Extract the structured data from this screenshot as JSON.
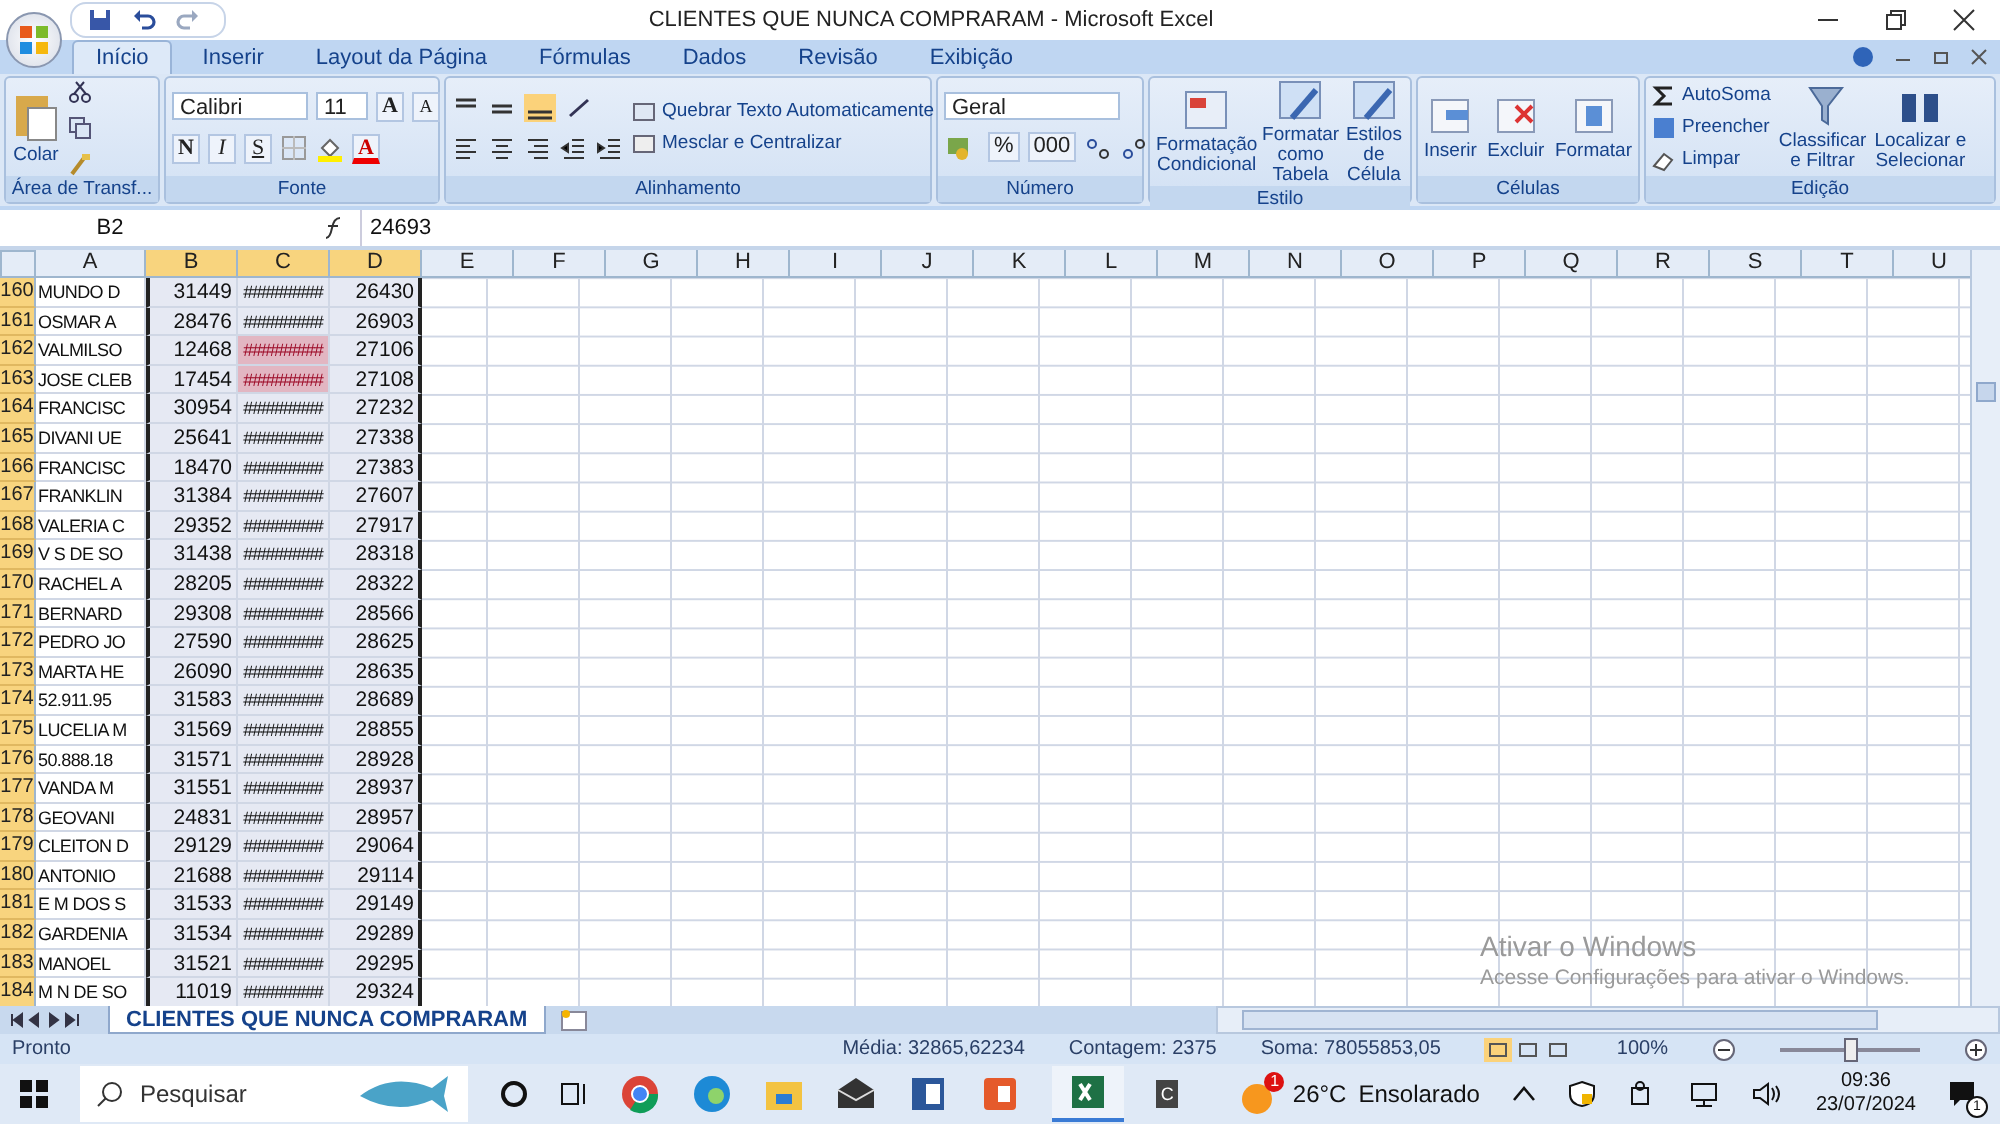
{
  "window": {
    "title": "CLIENTES QUE NUNCA COMPRARAM - Microsoft Excel"
  },
  "tabs": [
    {
      "label": "Início",
      "selected": true
    },
    {
      "label": "Inserir",
      "selected": false
    },
    {
      "label": "Layout da Página",
      "selected": false
    },
    {
      "label": "Fórmulas",
      "selected": false
    },
    {
      "label": "Dados",
      "selected": false
    },
    {
      "label": "Revisão",
      "selected": false
    },
    {
      "label": "Exibição",
      "selected": false
    }
  ],
  "ribbon": {
    "clipboard": {
      "paste": "Colar",
      "title": "Área de Transf..."
    },
    "font": {
      "name": "Calibri",
      "size": "11",
      "grow": "A",
      "shrink": "A",
      "styles": [
        "N",
        "I",
        "S"
      ],
      "color_letter": "A",
      "title": "Fonte"
    },
    "alignment": {
      "wrap": "Quebrar Texto Automaticamente",
      "merge": "Mesclar e Centralizar",
      "title": "Alinhamento"
    },
    "number": {
      "format": "Geral",
      "buttons": [
        "%",
        "000"
      ],
      "title": "Número"
    },
    "style": {
      "buttons": [
        "Formatação\nCondicional",
        "Formatar\ncomo Tabela",
        "Estilos de\nCélula"
      ],
      "title": "Estilo"
    },
    "cells": {
      "buttons": [
        "Inserir",
        "Excluir",
        "Formatar"
      ],
      "title": "Células"
    },
    "editing": {
      "items": [
        "AutoSoma",
        "Preencher",
        "Limpar"
      ],
      "buttons": [
        "Classificar\ne Filtrar",
        "Localizar e\nSelecionar"
      ],
      "title": "Edição"
    }
  },
  "name_box": "B2",
  "formula": "24693",
  "columns": [
    {
      "label": "A",
      "selected": false
    },
    {
      "label": "B",
      "selected": true
    },
    {
      "label": "C",
      "selected": true
    },
    {
      "label": "D",
      "selected": true
    },
    {
      "label": "E",
      "selected": false
    },
    {
      "label": "F",
      "selected": false
    },
    {
      "label": "G",
      "selected": false
    },
    {
      "label": "H",
      "selected": false
    },
    {
      "label": "I",
      "selected": false
    },
    {
      "label": "J",
      "selected": false
    },
    {
      "label": "K",
      "selected": false
    },
    {
      "label": "L",
      "selected": false
    },
    {
      "label": "M",
      "selected": false
    },
    {
      "label": "N",
      "selected": false
    },
    {
      "label": "O",
      "selected": false
    },
    {
      "label": "P",
      "selected": false
    },
    {
      "label": "Q",
      "selected": false
    },
    {
      "label": "R",
      "selected": false
    },
    {
      "label": "S",
      "selected": false
    },
    {
      "label": "T",
      "selected": false
    },
    {
      "label": "U",
      "selected": false
    }
  ],
  "rows": [
    {
      "num": "160",
      "a": "MUNDO D",
      "b": "31449",
      "c": "#########",
      "d": "26430",
      "highlighted": false
    },
    {
      "num": "161",
      "a": "OSMAR A",
      "b": "28476",
      "c": "#########",
      "d": "26903",
      "highlighted": false
    },
    {
      "num": "162",
      "a": "VALMILSO",
      "b": "12468",
      "c": "#########",
      "d": "27106",
      "highlighted": true
    },
    {
      "num": "163",
      "a": "JOSE CLEB",
      "b": "17454",
      "c": "#########",
      "d": "27108",
      "highlighted": true
    },
    {
      "num": "164",
      "a": "FRANCISC",
      "b": "30954",
      "c": "#########",
      "d": "27232",
      "highlighted": false
    },
    {
      "num": "165",
      "a": "DIVANI UE",
      "b": "25641",
      "c": "#########",
      "d": "27338",
      "highlighted": false
    },
    {
      "num": "166",
      "a": "FRANCISC",
      "b": "18470",
      "c": "#########",
      "d": "27383",
      "highlighted": false
    },
    {
      "num": "167",
      "a": "FRANKLIN",
      "b": "31384",
      "c": "#########",
      "d": "27607",
      "highlighted": false
    },
    {
      "num": "168",
      "a": "VALERIA C",
      "b": "29352",
      "c": "#########",
      "d": "27917",
      "highlighted": false
    },
    {
      "num": "169",
      "a": "V S DE SO",
      "b": "31438",
      "c": "#########",
      "d": "28318",
      "highlighted": false
    },
    {
      "num": "170",
      "a": "RACHEL A",
      "b": "28205",
      "c": "#########",
      "d": "28322",
      "highlighted": false
    },
    {
      "num": "171",
      "a": "BERNARD",
      "b": "29308",
      "c": "#########",
      "d": "28566",
      "highlighted": false
    },
    {
      "num": "172",
      "a": "PEDRO JO",
      "b": "27590",
      "c": "#########",
      "d": "28625",
      "highlighted": false
    },
    {
      "num": "173",
      "a": "MARTA HE",
      "b": "26090",
      "c": "#########",
      "d": "28635",
      "highlighted": false
    },
    {
      "num": "174",
      "a": "52.911.95",
      "b": "31583",
      "c": "#########",
      "d": "28689",
      "highlighted": false
    },
    {
      "num": "175",
      "a": "LUCELIA M",
      "b": "31569",
      "c": "#########",
      "d": "28855",
      "highlighted": false
    },
    {
      "num": "176",
      "a": "50.888.18",
      "b": "31571",
      "c": "#########",
      "d": "28928",
      "highlighted": false
    },
    {
      "num": "177",
      "a": "VANDA M",
      "b": "31551",
      "c": "#########",
      "d": "28937",
      "highlighted": false
    },
    {
      "num": "178",
      "a": "GEOVANI",
      "b": "24831",
      "c": "#########",
      "d": "28957",
      "highlighted": false
    },
    {
      "num": "179",
      "a": "CLEITON D",
      "b": "29129",
      "c": "#########",
      "d": "29064",
      "highlighted": false
    },
    {
      "num": "180",
      "a": "ANTONIO",
      "b": "21688",
      "c": "#########",
      "d": "29114",
      "highlighted": false
    },
    {
      "num": "181",
      "a": "E M DOS S",
      "b": "31533",
      "c": "#########",
      "d": "29149",
      "highlighted": false
    },
    {
      "num": "182",
      "a": "GARDENIA",
      "b": "31534",
      "c": "#########",
      "d": "29289",
      "highlighted": false
    },
    {
      "num": "183",
      "a": "MANOEL",
      "b": "31521",
      "c": "#########",
      "d": "29295",
      "highlighted": false
    },
    {
      "num": "184",
      "a": "M N DE SO",
      "b": "11019",
      "c": "#########",
      "d": "29324",
      "highlighted": false
    }
  ],
  "activation_notice": {
    "title": "Ativar o Windows",
    "text": "Acesse Configurações para ativar o Windows."
  },
  "sheet_tab": "CLIENTES QUE NUNCA COMPRARAM",
  "status_bar": {
    "state": "Pronto",
    "average": "Média: 32865,62234",
    "count": "Contagem: 2375",
    "sum": "Soma: 78055853,05",
    "zoom": "100%",
    "zoom_slider": {
      "level": 0.5
    }
  },
  "taskbar": {
    "search_placeholder": "Pesquisar",
    "app_letter": "C",
    "weather_badge": "1",
    "temperature": "26°C",
    "weather": "Ensolarado",
    "time": "09:36",
    "date": "23/07/2024",
    "notification_count": "1"
  }
}
